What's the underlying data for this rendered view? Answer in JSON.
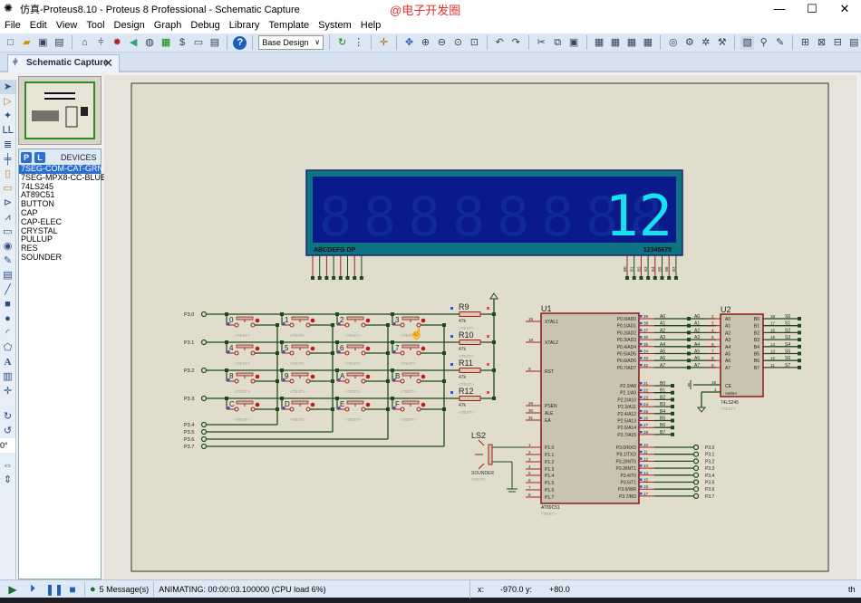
{
  "window": {
    "title": "仿真-Proteus8.10 - Proteus 8 Professional - Schematic Capture",
    "watermark": "@电子开发圈",
    "minimize": "—",
    "maximize": "☐",
    "close": "✕"
  },
  "menu": [
    "File",
    "Edit",
    "View",
    "Tool",
    "Design",
    "Graph",
    "Debug",
    "Library",
    "Template",
    "System",
    "Help"
  ],
  "toolbar": {
    "design_select": "Base Design"
  },
  "tab": {
    "label": "Schematic Capture",
    "close": "✕"
  },
  "devices": {
    "header": "DEVICES",
    "p": "P",
    "l": "L",
    "items": [
      "7SEG-COM-CAT-GRN",
      "7SEG-MPX8-CC-BLUE",
      "74LS245",
      "AT89C51",
      "BUTTON",
      "CAP",
      "CAP-ELEC",
      "CRYSTAL",
      "PULLUP",
      "RES",
      "SOUNDER"
    ],
    "selected": 0
  },
  "left_tools": {
    "angle": "0°"
  },
  "schematic": {
    "display": {
      "digits": "12",
      "seg_label": "ABCDEFG DP",
      "digit_label": "12345678",
      "pins_right": [
        "B0",
        "B1",
        "B2",
        "B3",
        "B4",
        "B5",
        "B6",
        "B7"
      ],
      "color": "#17e0f0"
    },
    "keypad": {
      "keys": [
        "0",
        "1",
        "2",
        "3",
        "4",
        "5",
        "6",
        "7",
        "8",
        "9",
        "A",
        "B",
        "C",
        "D",
        "E",
        "F"
      ],
      "rows": [
        "P3.0",
        "P3.1",
        "P3.2",
        "P3.3"
      ],
      "cols": [
        "P3.4",
        "P3.5",
        "P3.6",
        "P3.7"
      ],
      "text": "<TEXT>"
    },
    "resistors": [
      {
        "ref": "R9",
        "value": "47k"
      },
      {
        "ref": "R10",
        "value": "47k"
      },
      {
        "ref": "R11",
        "value": "47k"
      },
      {
        "ref": "R12",
        "value": "47k"
      }
    ],
    "sounder": {
      "ref": "LS2",
      "name": "SOUNDER",
      "text": "<TEXT>"
    },
    "u1": {
      "ref": "U1",
      "part": "AT89C51",
      "text": "<TEXT>",
      "left": [
        [
          "19",
          "XTAL1"
        ],
        [
          "18",
          "XTAL2"
        ],
        [
          "9",
          "RST"
        ],
        [
          "29",
          "PSEN"
        ],
        [
          "30",
          "ALE"
        ],
        [
          "31",
          "EA"
        ],
        [
          "1",
          "P1.0"
        ],
        [
          "2",
          "P1.1"
        ],
        [
          "3",
          "P1.2"
        ],
        [
          "4",
          "P1.3"
        ],
        [
          "5",
          "P1.4"
        ],
        [
          "6",
          "P1.5"
        ],
        [
          "7",
          "P1.6"
        ],
        [
          "8",
          "P1.7"
        ]
      ],
      "p0": [
        [
          "39",
          "P0.0/AD0",
          "A0"
        ],
        [
          "38",
          "P0.1/AD1",
          "A1"
        ],
        [
          "37",
          "P0.2/AD2",
          "A2"
        ],
        [
          "36",
          "P0.3/AD3",
          "A3"
        ],
        [
          "35",
          "P0.4/AD4",
          "A4"
        ],
        [
          "34",
          "P0.5/AD5",
          "A5"
        ],
        [
          "33",
          "P0.6/AD6",
          "A6"
        ],
        [
          "32",
          "P0.7/AD7",
          "A7"
        ]
      ],
      "p2": [
        [
          "21",
          "P2.0/A8",
          "B0"
        ],
        [
          "22",
          "P2.1/A9",
          "B1"
        ],
        [
          "23",
          "P2.2/A10",
          "B2"
        ],
        [
          "24",
          "P2.3/A11",
          "B3"
        ],
        [
          "25",
          "P2.4/A12",
          "B4"
        ],
        [
          "26",
          "P2.5/A13",
          "B5"
        ],
        [
          "27",
          "P2.6/A14",
          "B6"
        ],
        [
          "28",
          "P2.7/A15",
          "B7"
        ]
      ],
      "p3": [
        [
          "10",
          "P3.0/RXD",
          "P3.0"
        ],
        [
          "11",
          "P3.1/TXD",
          "P3.1"
        ],
        [
          "12",
          "P3.2/INT0",
          "P3.2"
        ],
        [
          "13",
          "P3.3/INT1",
          "P3.3"
        ],
        [
          "14",
          "P3.4/T0",
          "P3.4"
        ],
        [
          "15",
          "P3.5/T1",
          "P3.5"
        ],
        [
          "16",
          "P3.6/WR",
          "P3.6"
        ],
        [
          "17",
          "P3.7/RD",
          "P3.7"
        ]
      ]
    },
    "u2": {
      "ref": "U2",
      "part": "74LS245",
      "text": "<TEXT>",
      "a": [
        [
          "2",
          "A0"
        ],
        [
          "3",
          "A1"
        ],
        [
          "4",
          "A2"
        ],
        [
          "5",
          "A3"
        ],
        [
          "6",
          "A4"
        ],
        [
          "7",
          "A5"
        ],
        [
          "8",
          "A6"
        ],
        [
          "9",
          "A7"
        ]
      ],
      "b": [
        [
          "18",
          "B0",
          "S0"
        ],
        [
          "17",
          "B1",
          "S1"
        ],
        [
          "16",
          "B2",
          "S2"
        ],
        [
          "15",
          "B3",
          "S3"
        ],
        [
          "14",
          "B4",
          "S4"
        ],
        [
          "13",
          "B5",
          "S5"
        ],
        [
          "12",
          "B6",
          "S6"
        ],
        [
          "11",
          "B7",
          "S7"
        ]
      ],
      "ce": [
        "19",
        "CE"
      ],
      "dir": [
        "1",
        "AB/BA"
      ]
    }
  },
  "status": {
    "messages": "5 Message(s)",
    "animating": "ANIMATING: 00:00:03.100000 (CPU load 6%)",
    "x_label": "x:",
    "x": "-970.0",
    "y_label": "y:",
    "y": "+80.0",
    "units": "th"
  }
}
